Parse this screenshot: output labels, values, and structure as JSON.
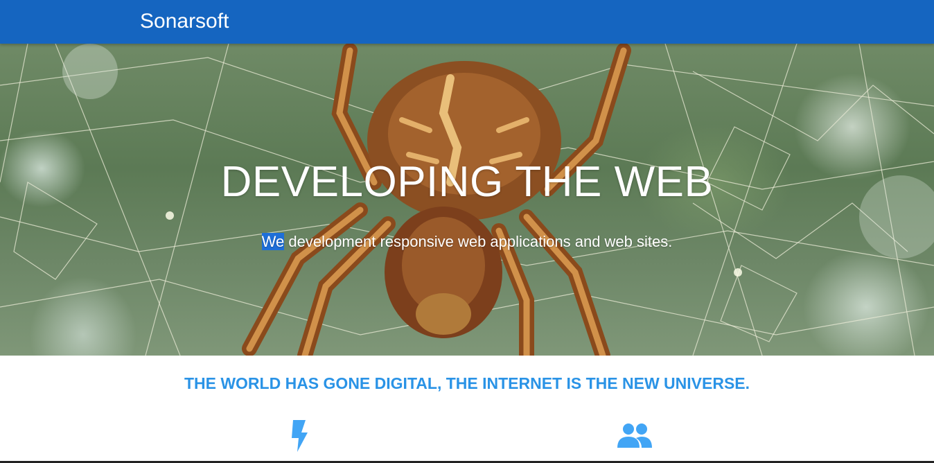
{
  "header": {
    "brand": "Sonarsoft",
    "color": "#1565c0"
  },
  "hero": {
    "title": "DEVELOPING THE WEB",
    "subtitle_first": "We",
    "subtitle_rest": " development responsive web applications and web sites.",
    "background": "spider-on-web-photo"
  },
  "section": {
    "tagline": "THE WORLD HAS GONE DIGITAL, THE INTERNET IS THE NEW UNIVERSE.",
    "accent_color": "#2a93e6",
    "features": [
      {
        "icon": "lightning-bolt-icon"
      },
      {
        "icon": "people-group-icon"
      }
    ]
  }
}
